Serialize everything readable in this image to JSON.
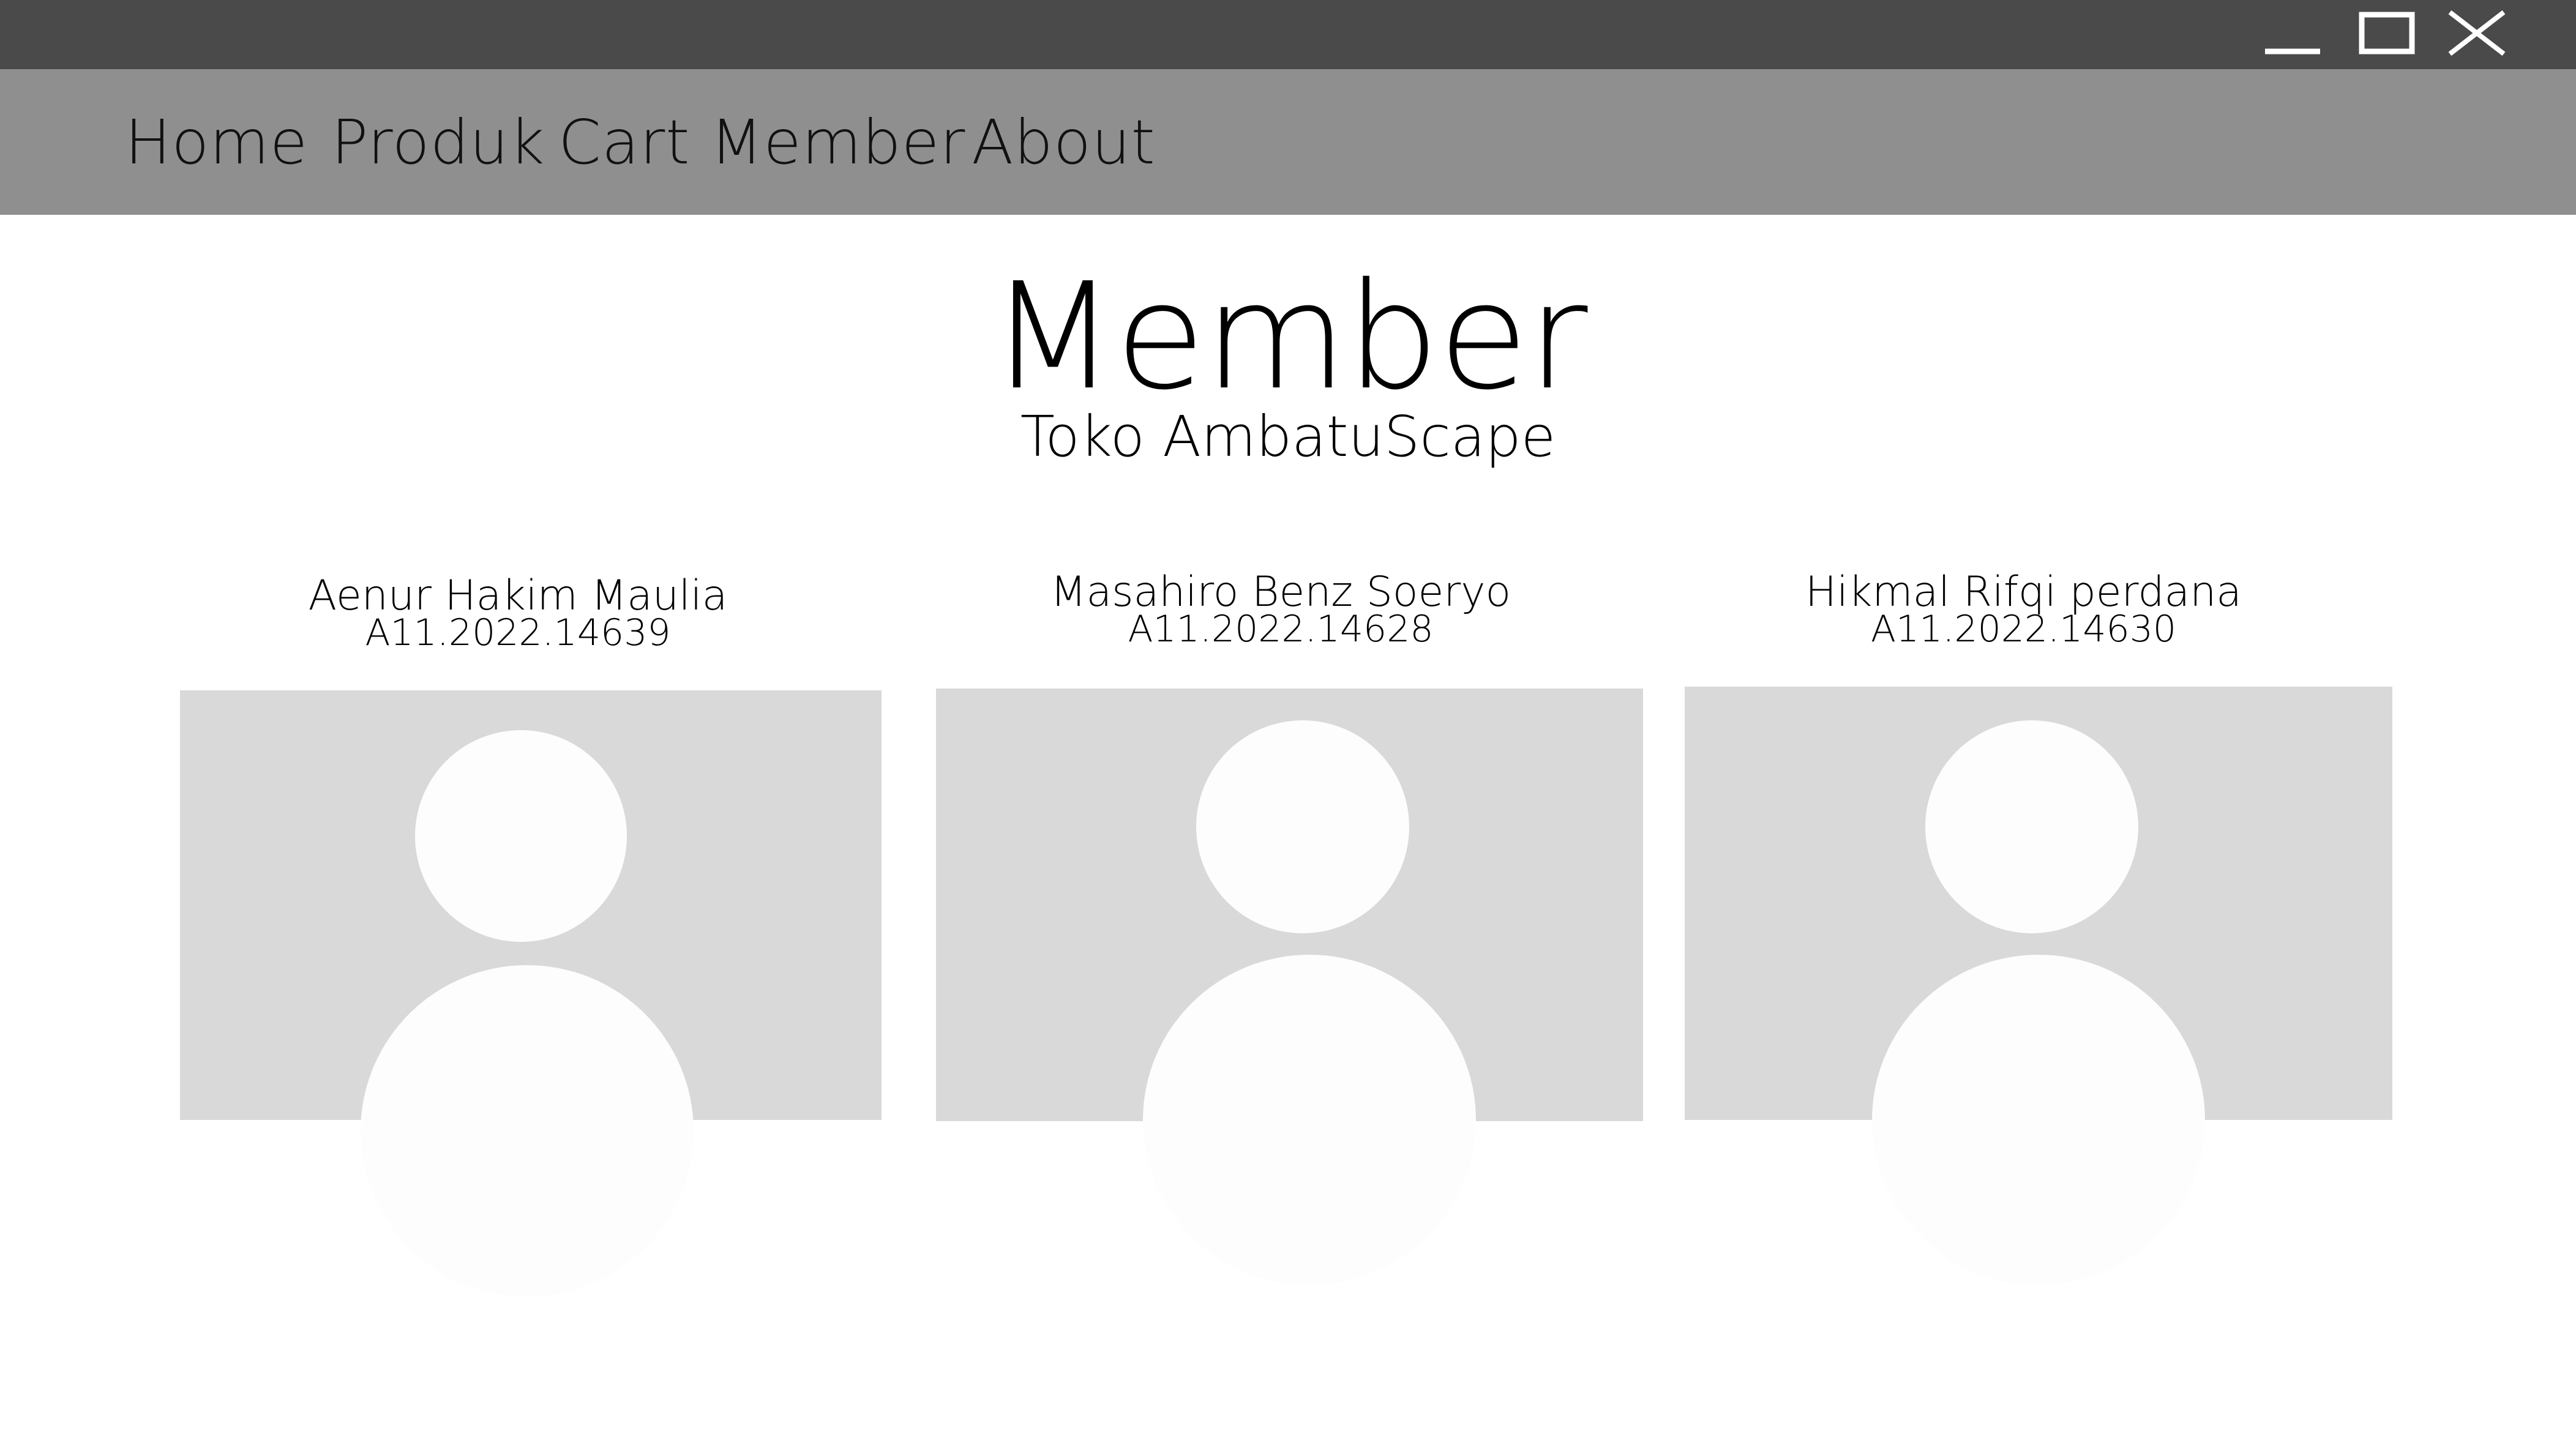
{
  "window": {
    "controls": [
      "minimize-icon",
      "maximize-icon",
      "close-icon"
    ]
  },
  "nav": {
    "items": [
      {
        "label": "Home"
      },
      {
        "label": "Produk"
      },
      {
        "label": "Cart"
      },
      {
        "label": "Member"
      },
      {
        "label": "About"
      }
    ]
  },
  "page": {
    "title": "Member",
    "subtitle": "Toko AmbatuScape"
  },
  "members": [
    {
      "name": "Aenur Hakim Maulia",
      "nim": "A11.2022.14639",
      "photo_icon": "user-avatar-icon"
    },
    {
      "name": "Masahiro Benz Soeryo",
      "nim": "A11.2022.14628",
      "photo_icon": "user-avatar-icon"
    },
    {
      "name": "Hikmal Rifqi perdana",
      "nim": "A11.2022.14630",
      "photo_icon": "user-avatar-icon"
    }
  ],
  "colors": {
    "titlebar": "#4a4a4a",
    "navbar": "#8f8f8f",
    "photo_placeholder": "#d9d9d9",
    "avatar": "#fdfdfd"
  }
}
